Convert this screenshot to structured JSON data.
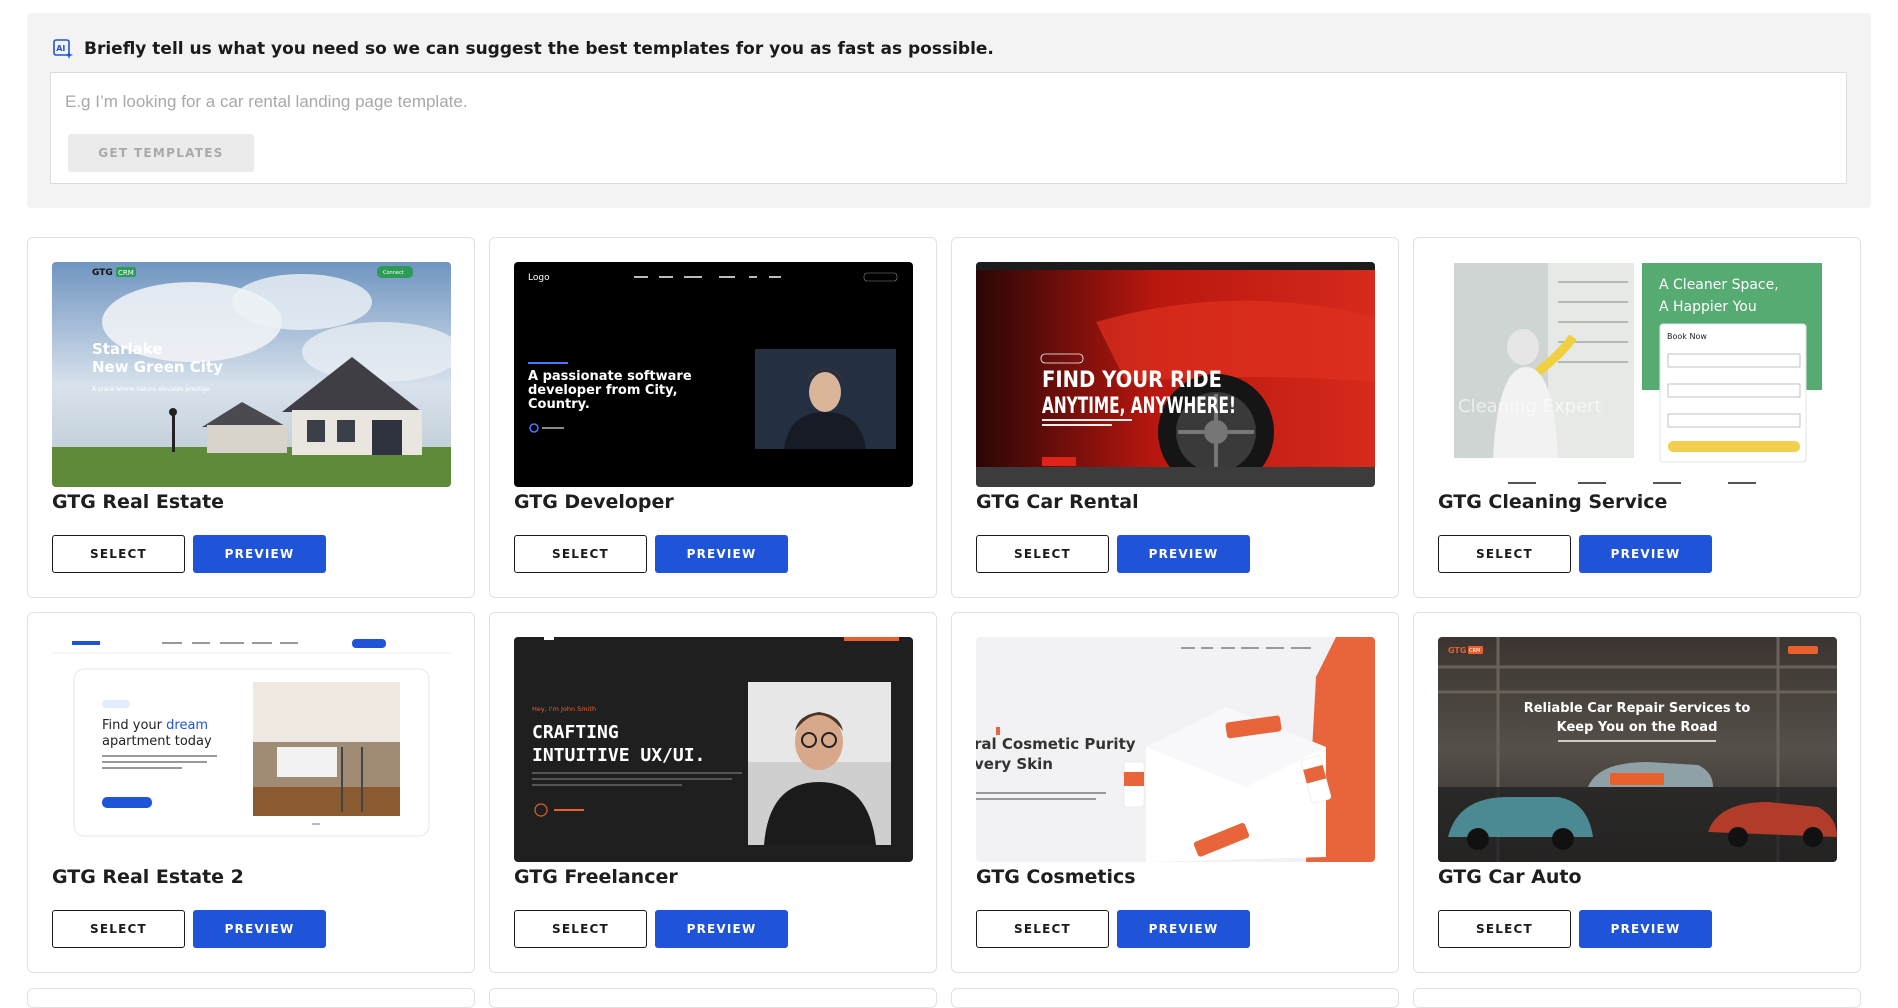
{
  "ai_panel": {
    "title": "Briefly tell us what you need so we can suggest the best templates for you as fast as possible.",
    "placeholder": "E.g I’m looking for a car rental landing page template.",
    "button_label": "GET TEMPLATES"
  },
  "templates": [
    {
      "name": "GTG Real Estate",
      "select_label": "SELECT",
      "preview_label": "PREVIEW",
      "thumb": {
        "brand": "GTG",
        "badge": "CRM",
        "headline1": "Starlake",
        "headline2": "New Green City",
        "sub": "A place where nature elevates prestige",
        "cta": "Connect"
      }
    },
    {
      "name": "GTG Developer",
      "select_label": "SELECT",
      "preview_label": "PREVIEW",
      "thumb": {
        "brand": "Logo",
        "headline1": "A passionate software",
        "headline2": "developer from City,",
        "headline3": "Country."
      }
    },
    {
      "name": "GTG Car Rental",
      "select_label": "SELECT",
      "preview_label": "PREVIEW",
      "thumb": {
        "headline1": "FIND YOUR RIDE",
        "headline2": "ANYTIME, ANYWHERE!"
      }
    },
    {
      "name": "GTG Cleaning Service",
      "select_label": "SELECT",
      "preview_label": "PREVIEW",
      "thumb": {
        "headline1": "A Cleaner Space,",
        "headline2": "A Happier You",
        "form_title": "Book Now",
        "overlay": "Cleaning Expert"
      }
    },
    {
      "name": "GTG Real Estate 2",
      "select_label": "SELECT",
      "preview_label": "PREVIEW",
      "thumb": {
        "headline1": "Find your ",
        "headline_accent": "dream",
        "headline2": "apartment today"
      }
    },
    {
      "name": "GTG Freelancer",
      "select_label": "SELECT",
      "preview_label": "PREVIEW",
      "thumb": {
        "kicker": "Hey, I'm John Smith",
        "headline1": "CRAFTING",
        "headline2": "INTUITIVE UX/UI."
      }
    },
    {
      "name": "GTG Cosmetics",
      "select_label": "SELECT",
      "preview_label": "PREVIEW",
      "thumb": {
        "headline1": "ral Cosmetic Purity",
        "headline2": "very Skin"
      }
    },
    {
      "name": "GTG Car Auto",
      "select_label": "SELECT",
      "preview_label": "PREVIEW",
      "thumb": {
        "headline1": "Reliable Car Repair Services to",
        "headline2": "Keep You on the Road",
        "brand": "GTG",
        "badge": "CRM"
      }
    }
  ],
  "colors": {
    "primary": "#1f54d8",
    "panel_bg": "#f3f3f3"
  }
}
